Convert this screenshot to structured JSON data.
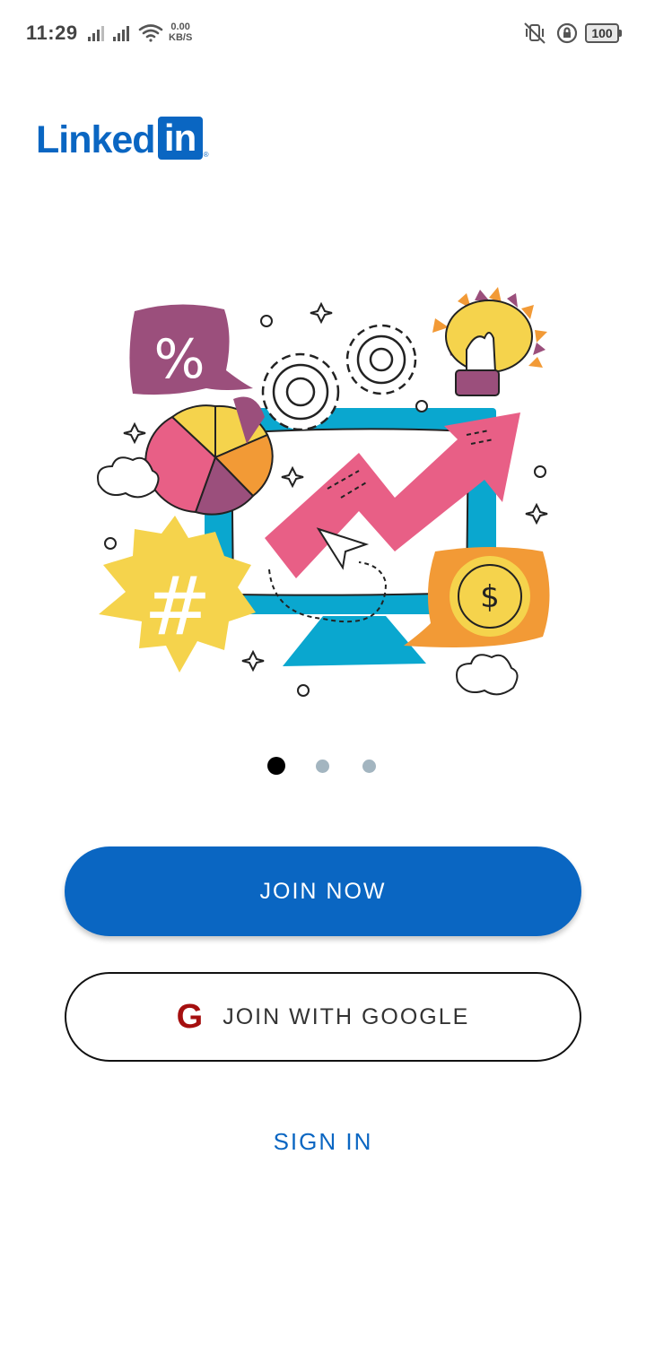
{
  "status_bar": {
    "time": "11:29",
    "net_speed_value": "0.00",
    "net_speed_unit": "KB/S",
    "battery": "100",
    "icons": [
      "signal-icon",
      "signal-icon",
      "wifi-icon",
      "vibrate-icon",
      "rotation-lock-icon",
      "battery-icon"
    ]
  },
  "logo": {
    "word": "Linked",
    "box": "in",
    "reg": "®"
  },
  "onboarding": {
    "illustration": "marketing-growth-illustration",
    "page_indicator": {
      "count": 3,
      "active": 1
    }
  },
  "actions": {
    "join_now": "JOIN NOW",
    "join_google": "JOIN WITH GOOGLE",
    "google_glyph": "G",
    "sign_in": "SIGN IN"
  },
  "colors": {
    "brand_blue": "#0a66c2",
    "dot_active": "#000000",
    "dot_inactive": "#a3b5c0",
    "google_red": "#a50f0f"
  }
}
